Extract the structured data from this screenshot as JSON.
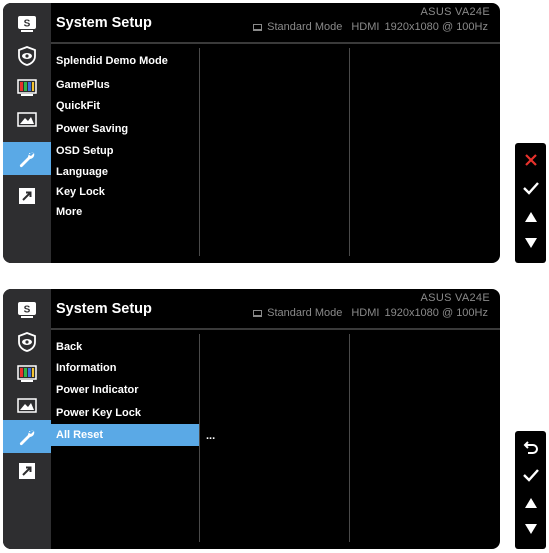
{
  "panels": [
    {
      "title": "System Setup",
      "model": "ASUS  VA24E",
      "mode": "Standard Mode",
      "input": "HDMI",
      "resolution": "1920x1080 @ 100Hz",
      "menu": [
        "Splendid Demo Mode",
        "GamePlus",
        "QuickFit",
        "Power Saving",
        "OSD Setup",
        "Language",
        "Key Lock",
        "More"
      ],
      "active_sidebar": "system-setup"
    },
    {
      "title": "System Setup",
      "model": "ASUS  VA24E",
      "mode": "Standard Mode",
      "input": "HDMI",
      "resolution": "1920x1080 @ 100Hz",
      "menu": [
        "Back",
        "Information",
        "Power Indicator",
        "Power Key Lock",
        "All Reset"
      ],
      "selected_item": "All Reset",
      "sub_value": "...",
      "active_sidebar": "system-setup"
    }
  ],
  "sidebar_icons": [
    "splendid-icon",
    "eye-care-icon",
    "color-icon",
    "image-icon",
    "system-setup-icon",
    "shortcut-icon"
  ],
  "keys_top": [
    "close-icon",
    "check-icon",
    "up-arrow-icon",
    "down-arrow-icon"
  ],
  "keys_bottom": [
    "back-icon",
    "check-icon",
    "up-arrow-icon",
    "down-arrow-icon"
  ],
  "colors": {
    "accent": "#5aa9e6",
    "close": "#e8322c",
    "sidebar": "#2e2e30"
  }
}
